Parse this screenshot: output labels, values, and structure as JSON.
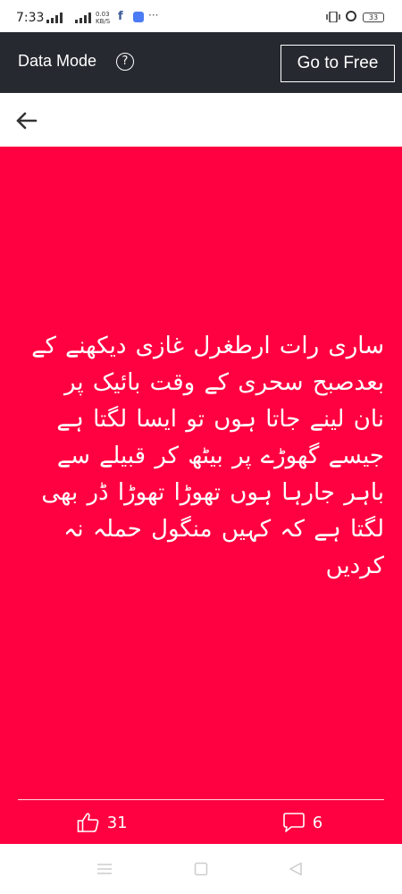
{
  "status_bar": {
    "time": "7:33",
    "net_speed_value": "0.03",
    "net_speed_unit": "KB/S",
    "overflow": "···",
    "battery": "33",
    "icons": [
      "signal-icon",
      "signal-icon",
      "facebook-icon",
      "messenger-icon",
      "vibrate-icon",
      "alarm-icon",
      "battery-icon"
    ]
  },
  "data_bar": {
    "title": "Data Mode",
    "help_symbol": "?",
    "cta_label": "Go to Free"
  },
  "post": {
    "background_color": "#ff0040",
    "text": "ساری رات ارطغرل غازی دیکھنے کے بعدصبح سحری کے وقت بائیک پر نان لینے جاتا ہوں تو ایسا لگتا ہے جیسے گھوڑے پر بیٹھ کر قبیلے سے باہر جارہا ہوں تھوڑا تھوڑا ڈر بھی لگتا ہے کہ کہیں منگول حملہ نہ کردیں",
    "likes": "31",
    "comments": "6"
  },
  "colors": {
    "data_bar_bg": "#262a30",
    "post_bg": "#ff0040",
    "text": "#ffffff"
  }
}
